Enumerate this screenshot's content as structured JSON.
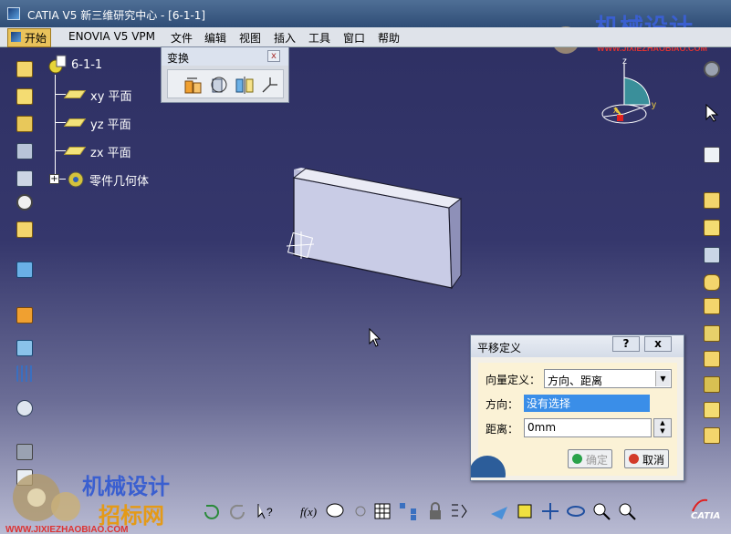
{
  "window": {
    "title": "CATIA V5  新三维研究中心 - [6-1-1]"
  },
  "menu": {
    "start": "开始",
    "items": [
      "ENOVIA V5 VPM",
      "文件",
      "编辑",
      "视图",
      "插入",
      "工具",
      "窗口",
      "帮助"
    ]
  },
  "tree": {
    "root": "6-1-1",
    "items": [
      {
        "label": "xy 平面",
        "icon": "plane-icon"
      },
      {
        "label": "yz 平面",
        "icon": "plane-icon"
      },
      {
        "label": "zx 平面",
        "icon": "plane-icon"
      },
      {
        "label": "零件几何体",
        "icon": "body-gear-icon"
      }
    ]
  },
  "transform_toolbar": {
    "title": "变换",
    "close": "x",
    "tools": [
      "translation-icon",
      "rotation-icon",
      "symmetry-icon",
      "axis-to-axis-icon"
    ]
  },
  "compass": {
    "x": "x",
    "y": "y",
    "z": "z"
  },
  "dialog": {
    "title": "平移定义",
    "help": "?",
    "close": "x",
    "vector_label": "向量定义：",
    "vector_value": "方向、距离",
    "direction_label": "方向：",
    "direction_value": "没有选择",
    "distance_label": "距离：",
    "distance_value": "0mm",
    "ok": "确定",
    "cancel": "取消"
  },
  "watermark": {
    "top_text": "机械设计",
    "top_url": "WWW.JIXIEZHAOBIAO.COM",
    "bottom_text1": "机械设计",
    "bottom_text2": "招标网",
    "bottom_url": "WWW.JIXIEZHAOBIAO.COM"
  },
  "brand": {
    "logo": "CATIA"
  },
  "colors": {
    "tree_text": "#ffffff",
    "accent": "#3a8ee8",
    "part_face": "#c9cce6"
  }
}
